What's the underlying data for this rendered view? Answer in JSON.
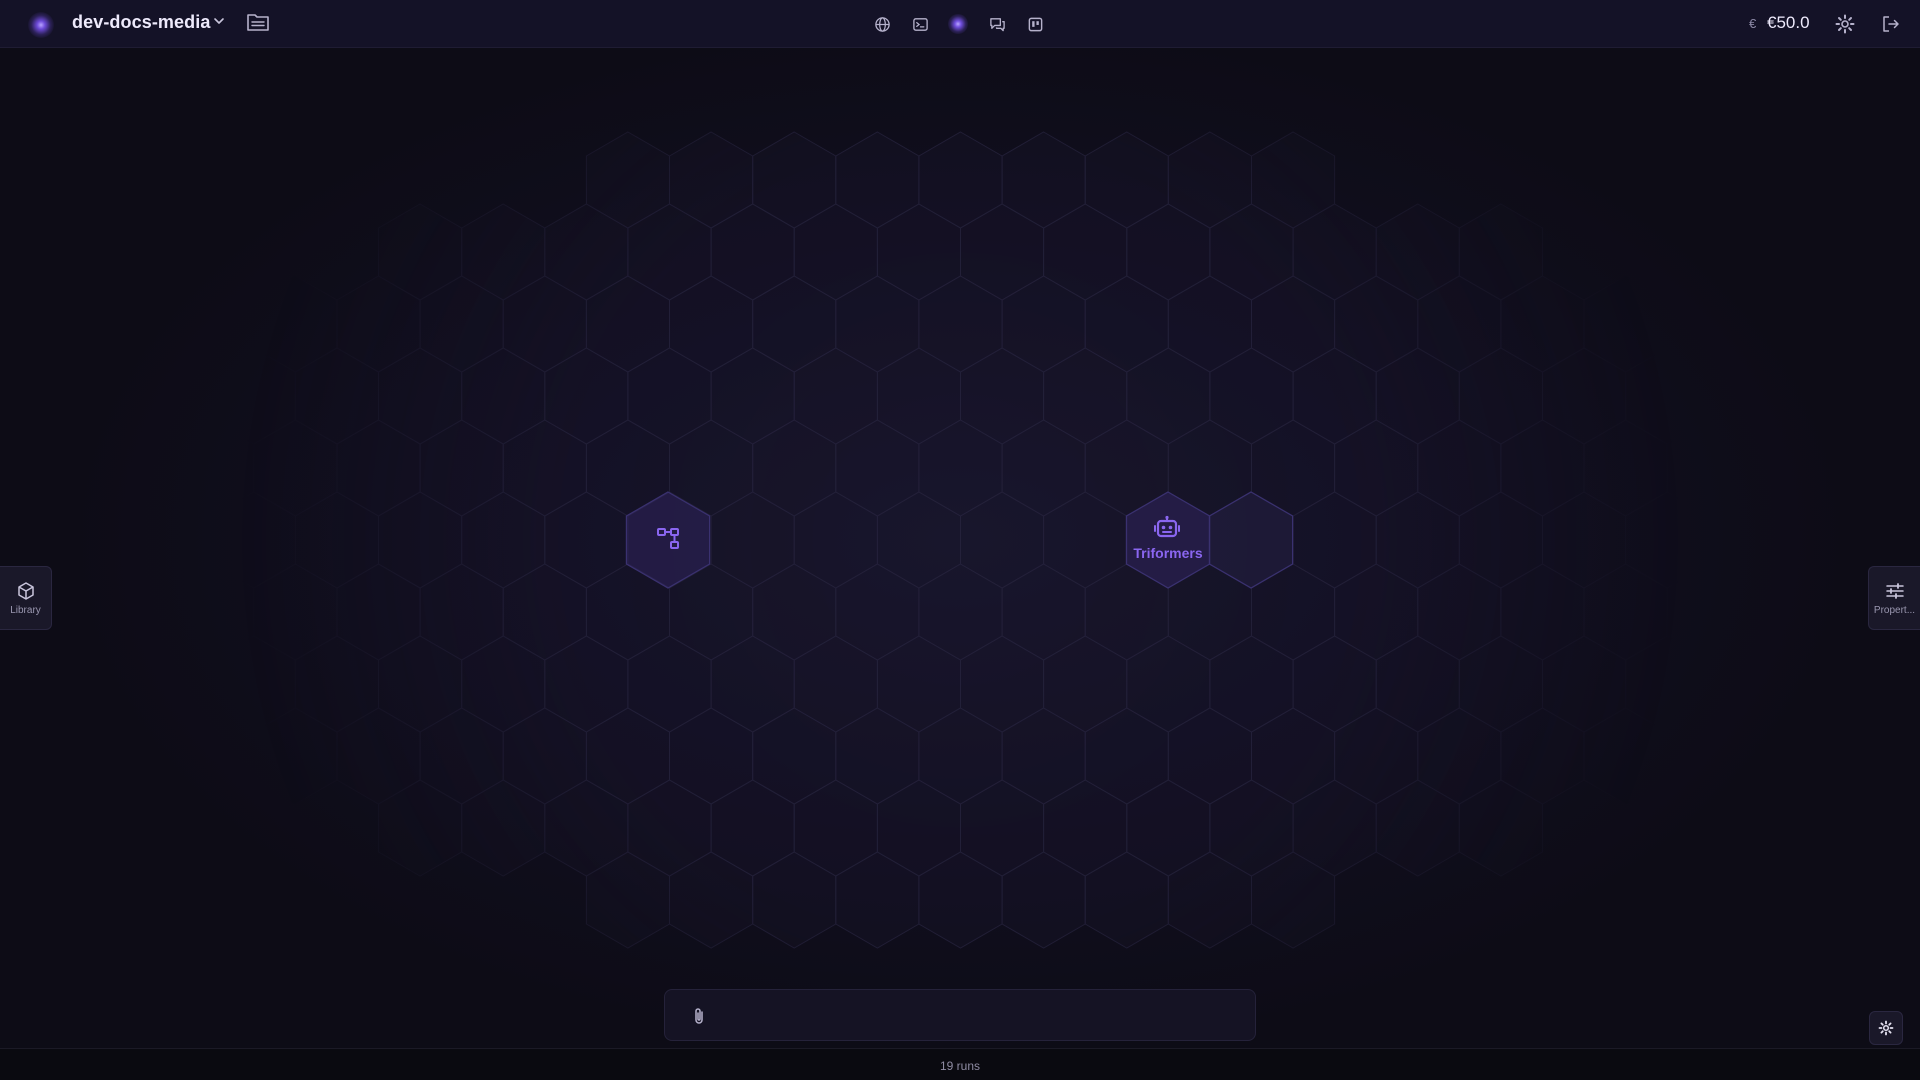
{
  "topbar": {
    "project_name": "dev-docs-media",
    "icons": {
      "logo": "orb-logo-icon",
      "project_menu": "chevron-down-icon",
      "folder": "folder-icon",
      "center": [
        "globe-icon",
        "terminal-icon",
        "orb-icon",
        "chat-icon",
        "board-icon"
      ],
      "settings": "gear-icon",
      "logout": "logout-icon"
    },
    "currency_symbol": "€",
    "balance": "€50.0"
  },
  "canvas": {
    "nodes": [
      {
        "id": "flow-node",
        "icon": "workflow-icon",
        "label": ""
      },
      {
        "id": "agent-node",
        "icon": "robot-icon",
        "label": "Triformers"
      }
    ]
  },
  "left_panel": {
    "label": "Library",
    "icon": "cube-icon"
  },
  "right_panel": {
    "label": "Propert...",
    "icon": "sliders-icon"
  },
  "chat": {
    "placeholder": "",
    "value": "",
    "attach_icon": "paperclip-icon"
  },
  "canvas_settings": {
    "icon": "gear-icon"
  },
  "footer": {
    "runs_text": "19 runs"
  },
  "colors": {
    "accent": "#8a66f0",
    "background": "#0d0c16",
    "topbar": "#141227",
    "hex_stroke": "#24213a"
  }
}
